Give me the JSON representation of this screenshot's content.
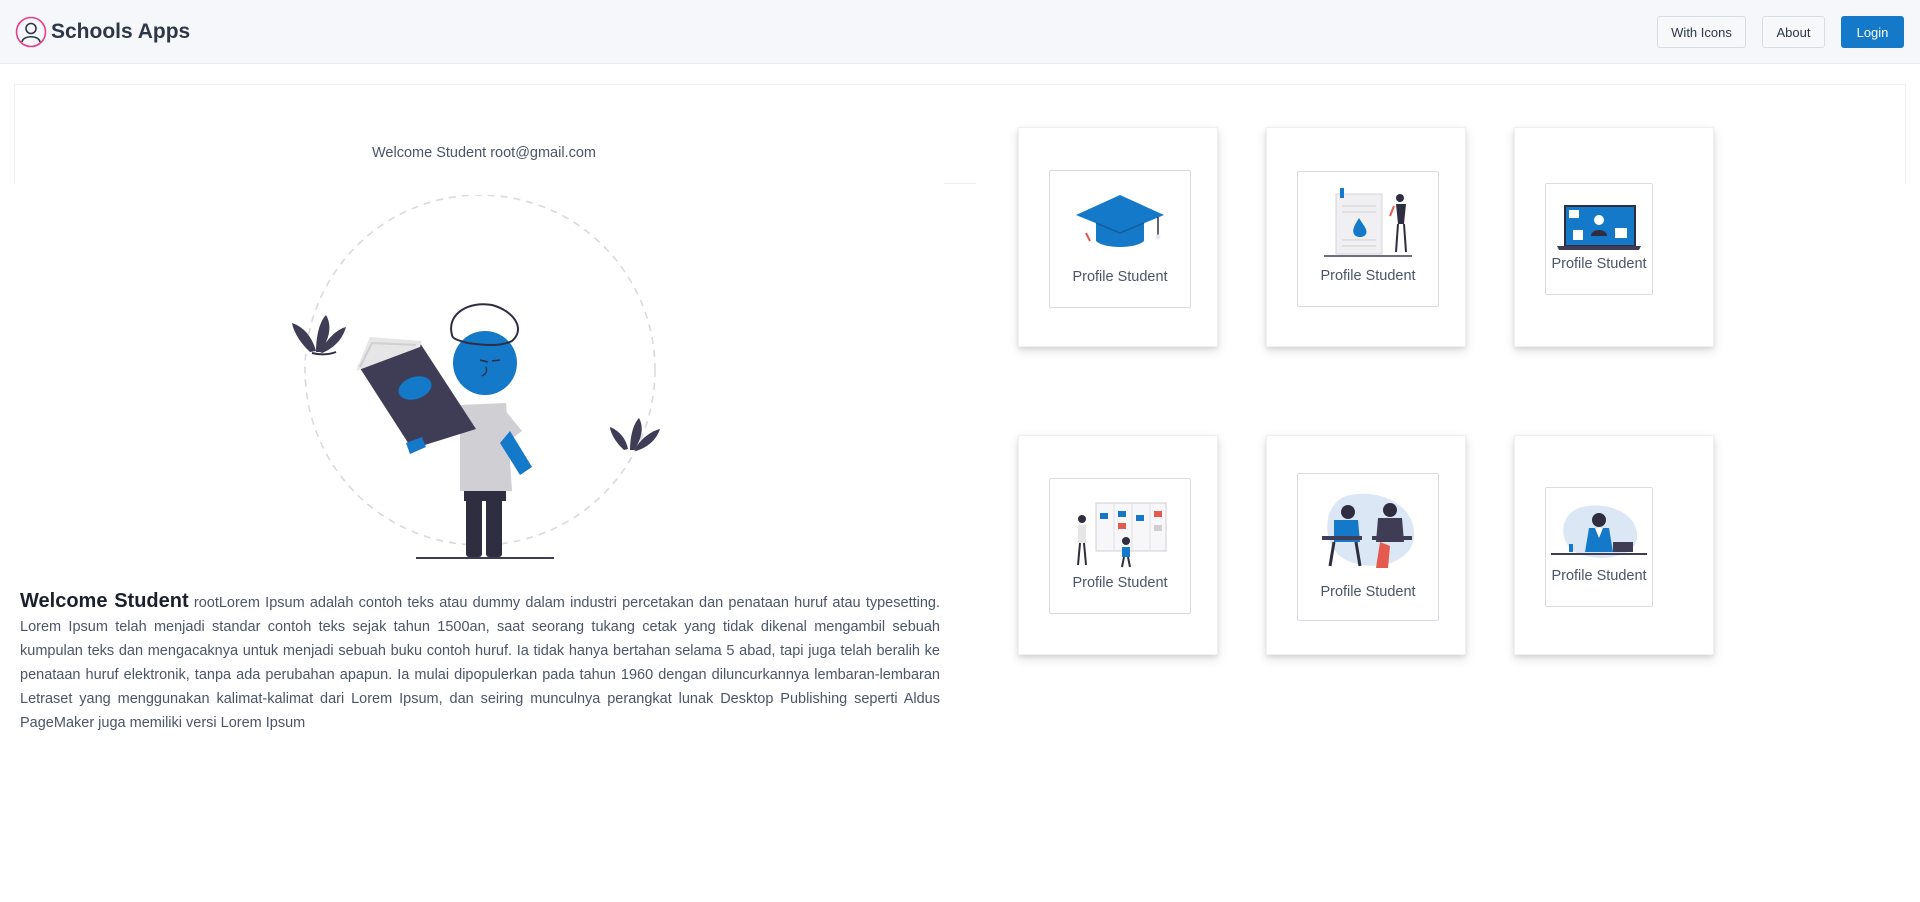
{
  "app": {
    "title": "Schools Apps"
  },
  "navbar": {
    "with_icons_label": "With Icons",
    "about_label": "About",
    "login_label": "Login"
  },
  "welcome": {
    "greeting": "Welcome Student root@gmail.com"
  },
  "intro": {
    "title": "Welcome Student",
    "body": "rootLorem Ipsum adalah contoh teks atau dummy dalam industri percetakan dan penataan huruf atau typesetting. Lorem Ipsum telah menjadi standar contoh teks sejak tahun 1500an, saat seorang tukang cetak yang tidak dikenal mengambil sebuah kumpulan teks dan mengacaknya untuk menjadi sebuah buku contoh huruf. Ia tidak hanya bertahan selama 5 abad, tapi juga telah beralih ke penataan huruf elektronik, tanpa ada perubahan apapun. Ia mulai dipopulerkan pada tahun 1960 dengan diluncurkannya lembaran-lembaran Letraset yang menggunakan kalimat-kalimat dari Lorem Ipsum, dan seiring munculnya perangkat lunak Desktop Publishing seperti Aldus PageMaker juga memiliki versi Lorem Ipsum"
  },
  "cards": [
    {
      "label": "Profile Student",
      "icon": "graduation-cap-icon"
    },
    {
      "label": "Profile Student",
      "icon": "document-person-icon"
    },
    {
      "label": "Profile Student",
      "icon": "online-class-icon"
    },
    {
      "label": "Profile Student",
      "icon": "kanban-board-icon"
    },
    {
      "label": "Profile Student",
      "icon": "students-studying-icon"
    },
    {
      "label": "Profile Student",
      "icon": "laptop-student-icon"
    }
  ],
  "colors": {
    "primary": "#1479c9",
    "accent": "#e83e8c",
    "dark": "#2f2e41"
  }
}
